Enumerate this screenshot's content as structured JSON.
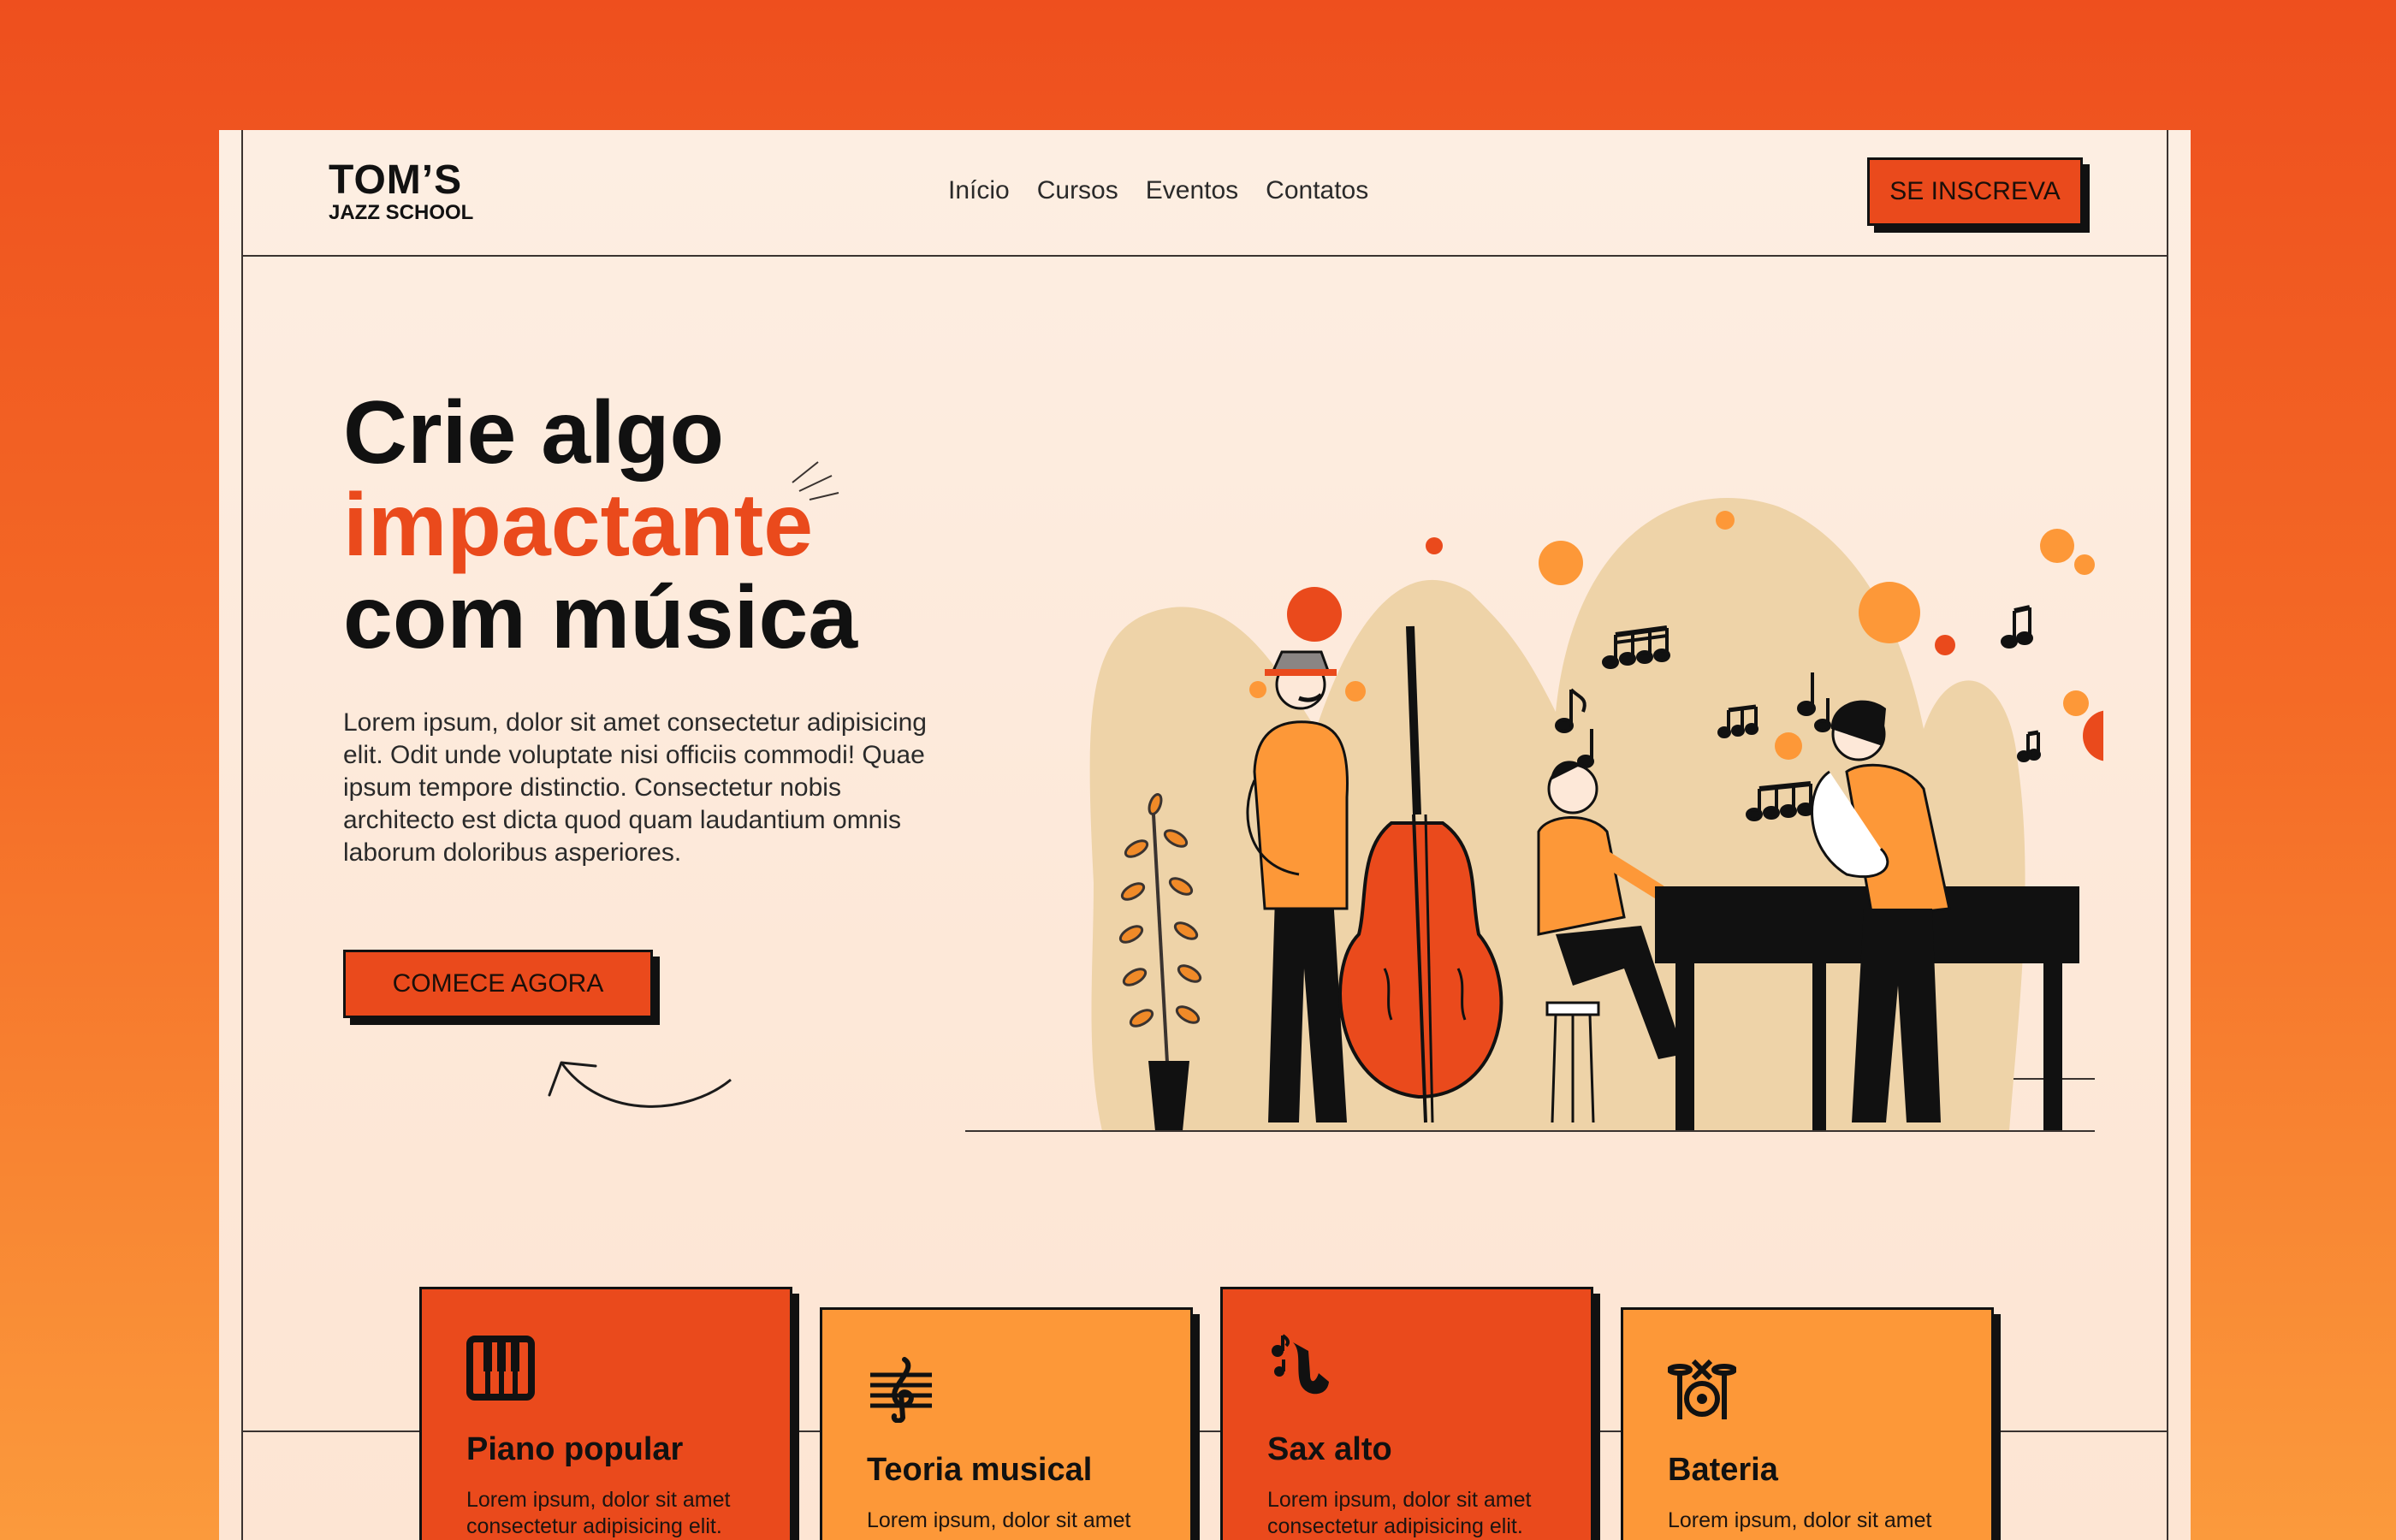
{
  "header": {
    "logo_line1": "TOM’S",
    "logo_line2": "JAZZ SCHOOL",
    "nav": [
      "Início",
      "Cursos",
      "Eventos",
      "Contatos"
    ],
    "signup_label": "SE INSCREVA"
  },
  "hero": {
    "title_line1": "Crie algo",
    "title_line2": "impactante",
    "title_line3": "com música",
    "description": "Lorem ipsum, dolor sit amet consectetur adipisicing elit. Odit unde voluptate nisi officiis commodi! Quae ipsum tempore distinctio. Consectetur nobis architecto est dicta quod quam laudantium omnis laborum doloribus asperiores.",
    "cta_label": "COMECE AGORA"
  },
  "courses": [
    {
      "title": "Piano popular",
      "text": "Lorem ipsum, dolor sit amet consectetur adipisicing elit. Odit",
      "icon": "piano-keys-icon"
    },
    {
      "title": "Teoria musical",
      "text": "Lorem ipsum, dolor sit amet",
      "icon": "treble-clef-icon"
    },
    {
      "title": "Sax alto",
      "text": "Lorem ipsum, dolor sit amet consectetur adipisicing elit. Odit",
      "icon": "saxophone-icon"
    },
    {
      "title": "Bateria",
      "text": "Lorem ipsum, dolor sit amet",
      "icon": "drum-kit-icon"
    }
  ],
  "colors": {
    "background": "#ee4f1e",
    "page": "#fdeee2",
    "accent": "#ea4a1c",
    "orange": "#fd9838",
    "dark": "#111111"
  }
}
